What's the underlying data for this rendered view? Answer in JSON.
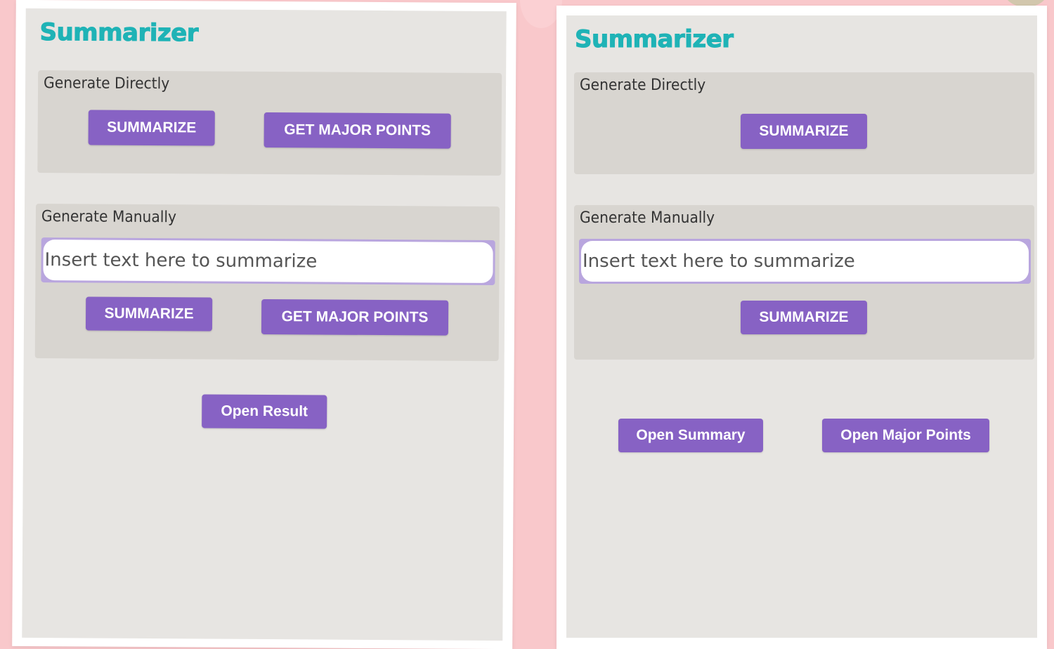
{
  "colors": {
    "background": "#f9c8cb",
    "panel": "#e7e5e2",
    "section": "#d8d5d0",
    "title": "#1fb3b6",
    "button": "#8762c4",
    "input_border": "#b9a6de"
  },
  "left_screen": {
    "title": "Summarizer",
    "direct": {
      "label": "Generate Directly",
      "summarize": "SUMMARIZE",
      "major_points": "GET MAJOR POINTS"
    },
    "manual": {
      "label": "Generate Manually",
      "placeholder": "Insert text here to summarize",
      "summarize": "SUMMARIZE",
      "major_points": "GET MAJOR POINTS"
    },
    "open_result": "Open Result"
  },
  "right_screen": {
    "title": "Summarizer",
    "direct": {
      "label": "Generate Directly",
      "summarize": "SUMMARIZE"
    },
    "manual": {
      "label": "Generate Manually",
      "placeholder": "Insert text here to summarize",
      "summarize": "SUMMARIZE"
    },
    "open_summary": "Open Summary",
    "open_major_points": "Open Major Points"
  }
}
